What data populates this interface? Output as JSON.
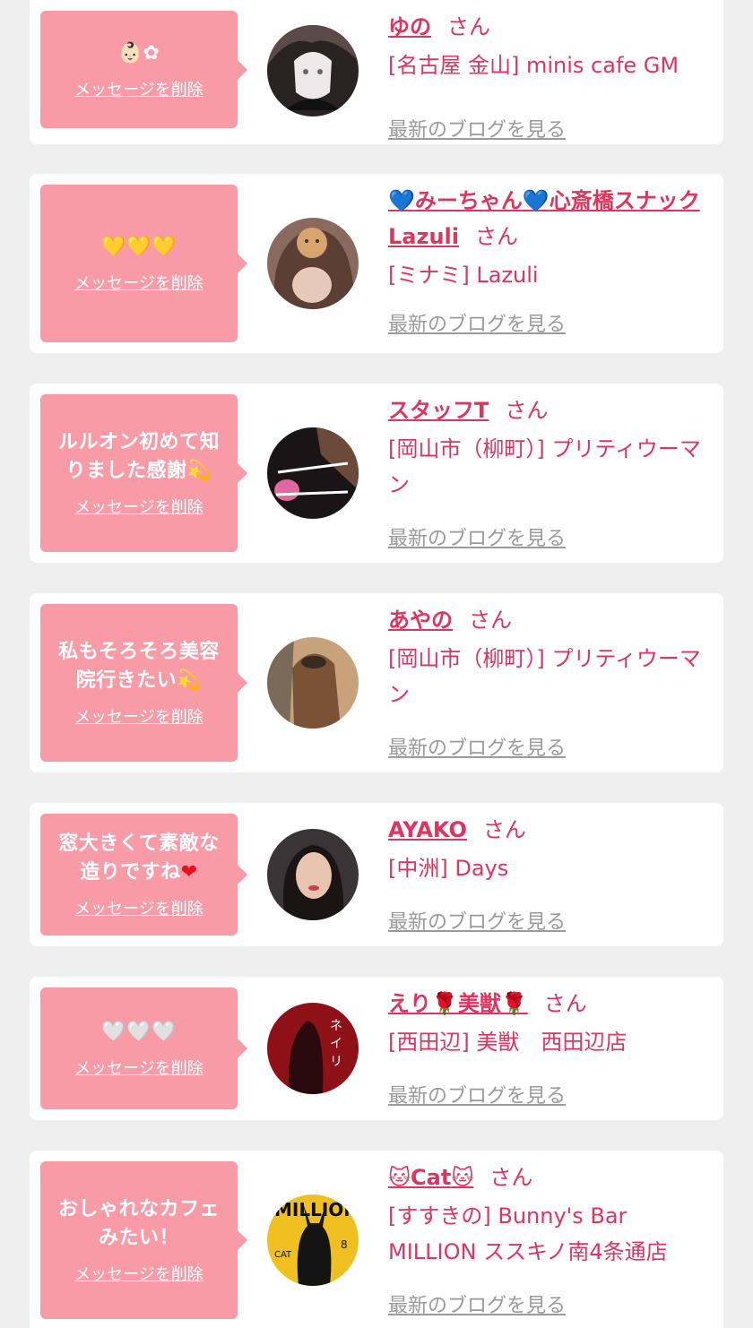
{
  "delete_label": "メッセージを削除",
  "san": "さん",
  "blog_label": "最新のブログを見る",
  "colors": {
    "bubble": "#f99aa7",
    "accent": "#e0345e",
    "link_gray": "#9a9a9a",
    "background": "#efefef"
  },
  "cards": [
    {
      "message": "👶🏻✿",
      "name": "ゆの",
      "shop": "[名古屋 金山] minis cafe GM"
    },
    {
      "message": "💛💛💛",
      "name_prefix": "💙",
      "name": "みーちゃん",
      "name_mid": "💙",
      "name_rest": "心斎橋スナックLazuli",
      "shop": "[ミナミ] Lazuli"
    },
    {
      "message": "ルルオン初めて知りました感謝",
      "message_emoji": "💫",
      "name": "スタッフT",
      "shop": "[岡山市（柳町）] プリティウーマン"
    },
    {
      "message": "私もそろそろ美容院行きたい",
      "message_emoji": "💫",
      "name": "あやの",
      "shop": "[岡山市（柳町）] プリティウーマン"
    },
    {
      "message": "窓大きくて素敵な造りですね",
      "message_emoji": "❤",
      "name": "AYAKO",
      "shop": "[中洲] Days"
    },
    {
      "message": "🤍🤍🤍",
      "name": "えり",
      "name_mid": "🌹",
      "name_rest": "美獣",
      "name_suffix": "🌹",
      "shop": "[西田辺] 美獣　西田辺店"
    },
    {
      "message": "おしゃれなカフェみたい！",
      "name_prefix": "🐱",
      "name": "Cat",
      "name_suffix": "🐱",
      "shop": "[すすきの] Bunny's Bar MILLION ススキノ南4条通店"
    }
  ]
}
